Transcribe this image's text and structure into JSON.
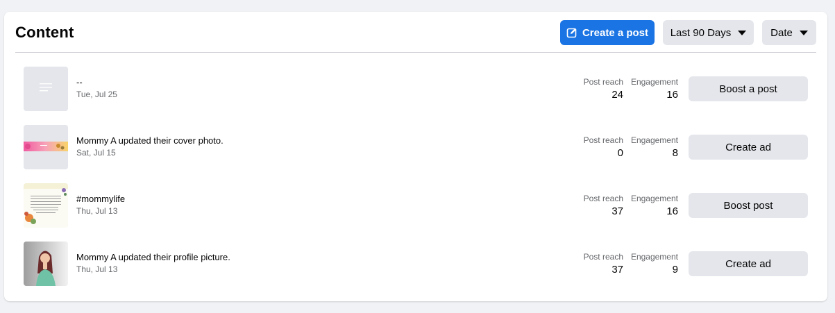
{
  "header": {
    "title": "Content",
    "create_post_label": "Create a post",
    "range_label": "Last 90 Days",
    "sort_label": "Date"
  },
  "posts": [
    {
      "title": "--",
      "date": "Tue, Jul 25",
      "reach_label": "Post reach",
      "reach": "24",
      "engagement_label": "Engagement",
      "engagement": "16",
      "action": "Boost a post",
      "thumbnail": "text-placeholder-icon"
    },
    {
      "title": "Mommy A updated their cover photo.",
      "date": "Sat, Jul 15",
      "reach_label": "Post reach",
      "reach": "0",
      "engagement_label": "Engagement",
      "engagement": "8",
      "action": "Create ad",
      "thumbnail": "cover-photo-thumbnail"
    },
    {
      "title": "#mommylife",
      "date": "Thu, Jul 13",
      "reach_label": "Post reach",
      "reach": "37",
      "engagement_label": "Engagement",
      "engagement": "16",
      "action": "Boost post",
      "thumbnail": "post-image-thumbnail"
    },
    {
      "title": "Mommy A updated their profile picture.",
      "date": "Thu, Jul 13",
      "reach_label": "Post reach",
      "reach": "37",
      "engagement_label": "Engagement",
      "engagement": "9",
      "action": "Create ad",
      "thumbnail": "profile-picture-thumbnail"
    }
  ],
  "colors": {
    "primary": "#1b74e4",
    "secondary_button": "#e4e6eb",
    "muted_text": "#65676b"
  }
}
